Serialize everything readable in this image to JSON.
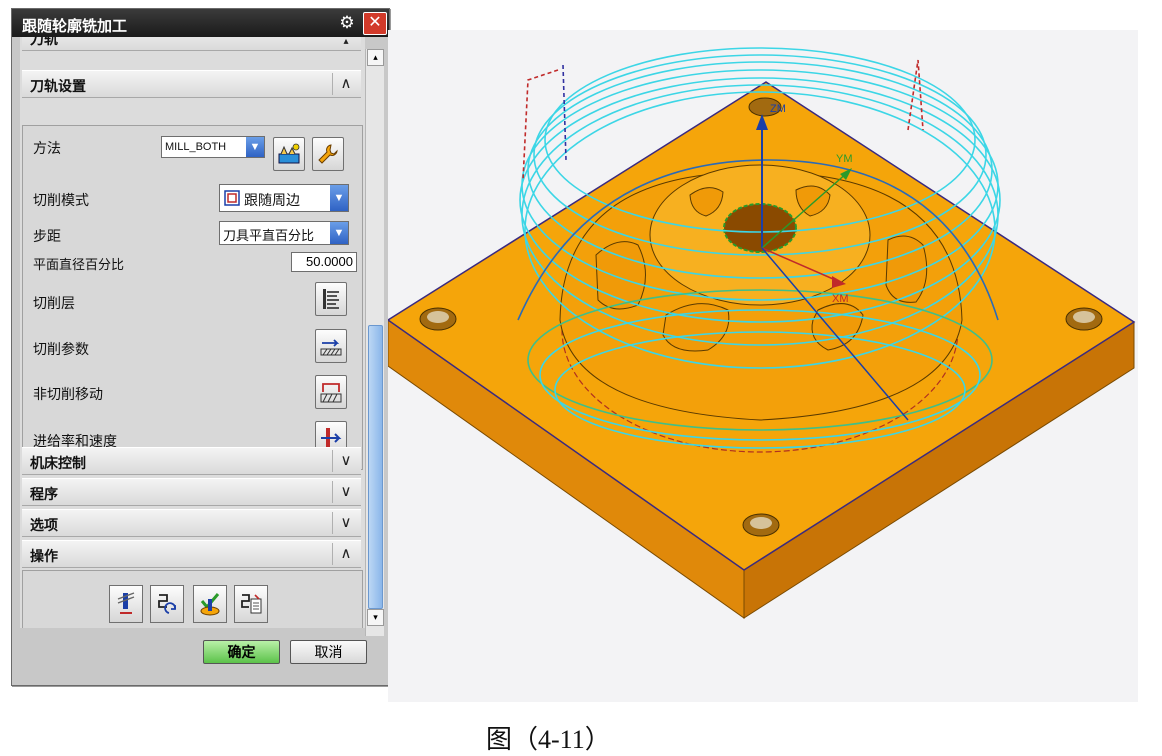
{
  "dialog": {
    "title": "跟随轮廓铣加工",
    "gear_icon": "gear-icon",
    "close_icon": "close-icon",
    "sections": {
      "top_partial": {
        "label": "刀轨",
        "expanded": false
      },
      "toolpath_settings": {
        "label": "刀轨设置",
        "expanded": true
      },
      "machine_control": {
        "label": "机床控制",
        "expanded": false
      },
      "program": {
        "label": "程序",
        "expanded": false
      },
      "options": {
        "label": "选项",
        "expanded": false
      },
      "actions": {
        "label": "操作",
        "expanded": true
      }
    },
    "fields": {
      "method_label": "方法",
      "method_value": "MILL_BOTH",
      "cut_pattern_label": "切削模式",
      "cut_pattern_value": "跟随周边",
      "stepover_label": "步距",
      "stepover_value": "刀具平直百分比",
      "percent_label": "平面直径百分比",
      "percent_value": "50.0000",
      "cut_levels_label": "切削层",
      "cut_params_label": "切削参数",
      "noncut_moves_label": "非切削移动",
      "feeds_speeds_label": "进给率和速度"
    },
    "buttons": {
      "ok_label": "确定",
      "cancel_label": "取消"
    }
  },
  "viewport": {
    "axis_labels": {
      "z": "ZM",
      "y": "YM",
      "x": "XM"
    }
  },
  "caption": "图（4-11）",
  "colors": {
    "part_orange": "#f5a50a",
    "toolpath_cyan": "#3cd6e6",
    "ok_green": "#5cc24a",
    "close_red": "#d23a2a"
  }
}
